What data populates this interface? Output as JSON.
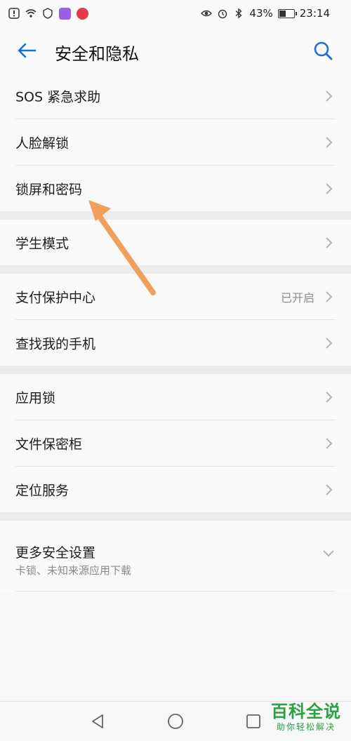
{
  "statusbar": {
    "battery": "43%",
    "time": "23:14",
    "battery_level": 0.43
  },
  "header": {
    "title": "安全和隐私"
  },
  "groups": [
    [
      "SOS 紧急求助",
      "人脸解锁",
      "锁屏和密码"
    ],
    [
      "学生模式"
    ],
    [
      "支付保护中心",
      "查找我的手机"
    ],
    [
      "应用锁",
      "文件保密柜",
      "定位服务"
    ]
  ],
  "payment_status": "已开启",
  "more": {
    "title": "更多安全设置",
    "subtitle": "卡锁、未知来源应用下载"
  },
  "watermark": {
    "title": "百科全说",
    "subtitle": "助你轻松解决"
  },
  "colors": {
    "accent": "#1a6fd8",
    "arrow": "#f0a05a",
    "watermark": "#2aa145"
  }
}
